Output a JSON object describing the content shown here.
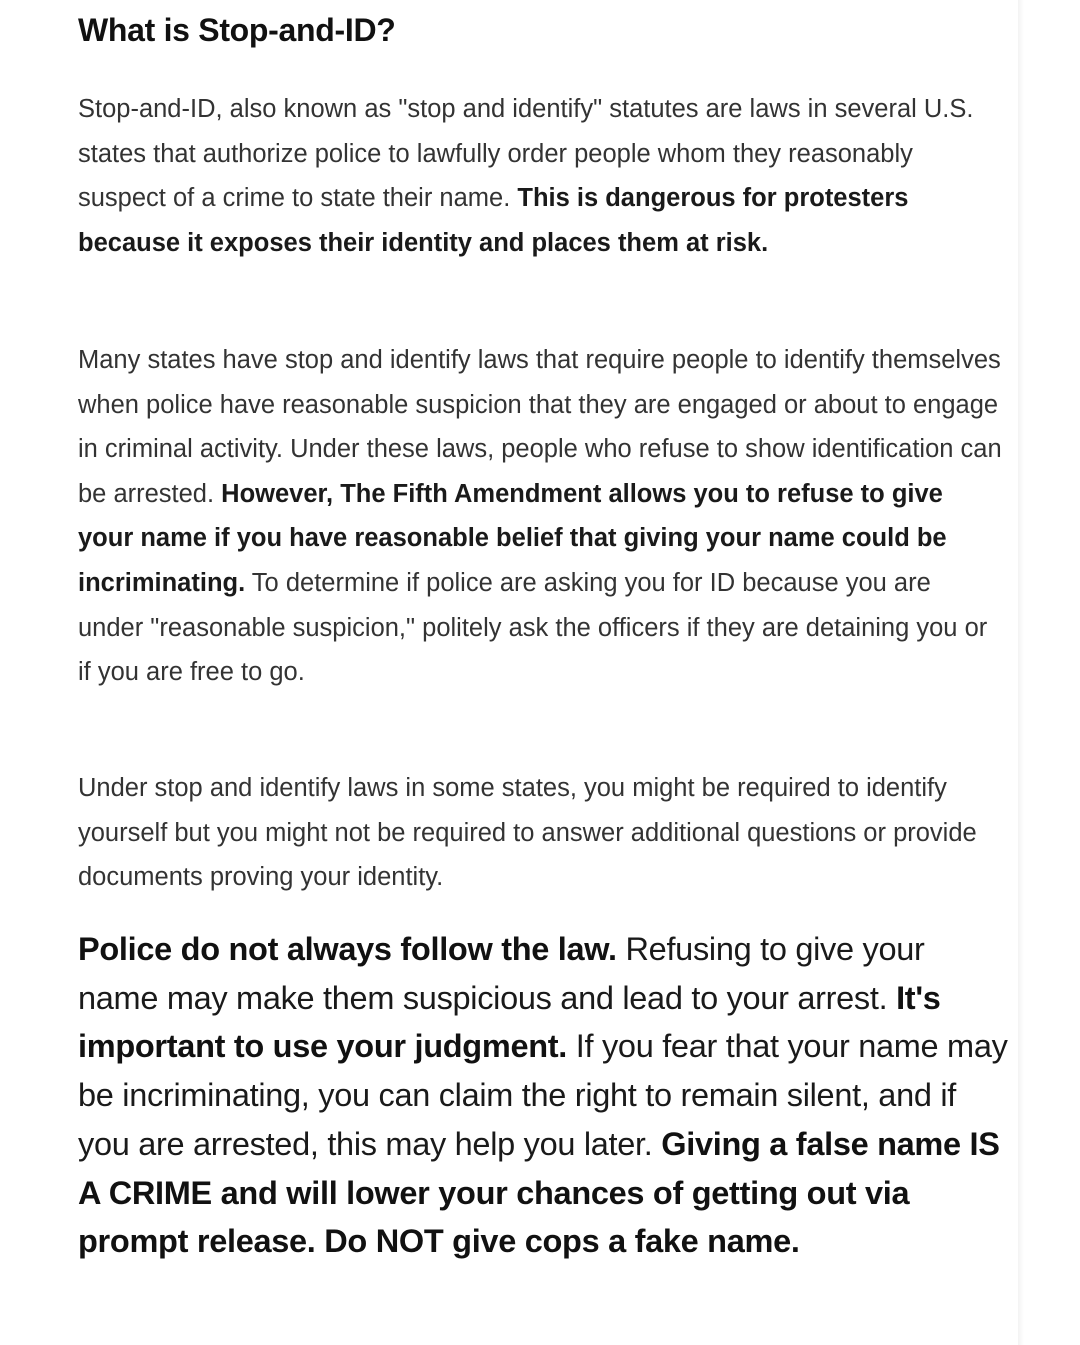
{
  "article": {
    "heading": "What is Stop-and-ID?",
    "paragraph_1": {
      "text_1": "Stop-and-ID, also known as \"stop and identify\" statutes are laws in several U.S. states that authorize police to lawfully order people whom they reasonably suspect of a crime to state their name. ",
      "bold_1": "This is dangerous for protesters because it exposes their identity and places them at risk."
    },
    "paragraph_2": {
      "text_1": "Many states have stop and identify laws that require people to identify themselves when police have reasonable suspicion that they are engaged or about to engage in criminal activity. Under these laws, people who refuse to show identification can be arrested. ",
      "bold_1": "However, The Fifth Amendment allows you to refuse to give your name if you have reasonable belief that giving your name could be incriminating.",
      "text_2": " To determine if police are asking you for ID because you are under \"reasonable suspicion,\" politely ask the officers if they are detaining you or if you are free to go."
    },
    "paragraph_3": {
      "text_1": "Under stop and identify laws in some states, you might be required to identify yourself but you might not be required to answer additional questions or provide documents proving your identity."
    },
    "paragraph_4": {
      "bold_1": "Police do not always follow the law.",
      "text_1": " Refusing to give your name may make them suspicious and lead to your arrest. ",
      "bold_2": "It's important to use your judgment.",
      "text_2": " If you fear that your name may be incriminating, you can claim the right to remain silent, and if you are arrested, this may help you later. ",
      "bold_3": "Giving a false name IS A CRIME and will lower your chances of getting out via prompt release. Do NOT give cops a fake name."
    }
  }
}
